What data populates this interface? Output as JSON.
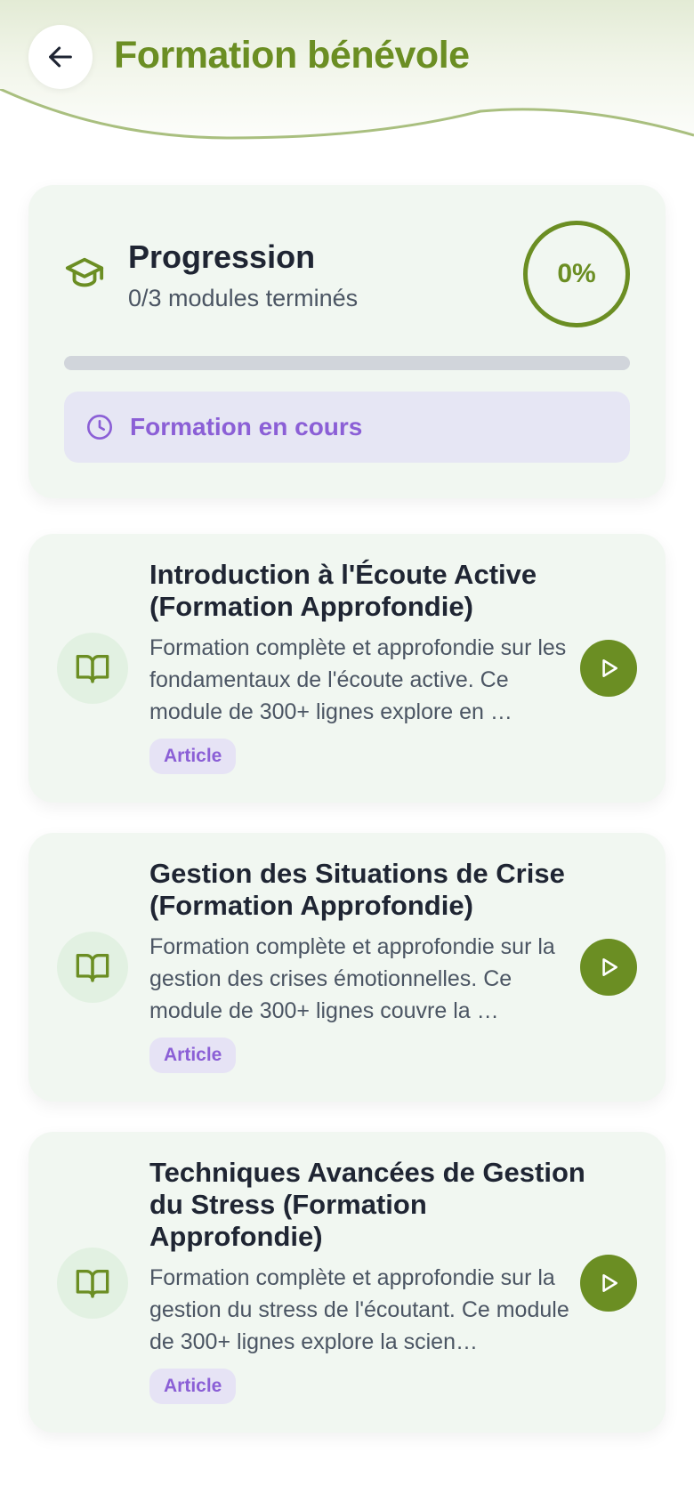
{
  "header": {
    "title": "Formation bénévole",
    "back_icon": "arrow-left-icon"
  },
  "progress": {
    "icon": "graduation-cap-icon",
    "title": "Progression",
    "subtitle": "0/3 modules terminés",
    "percent_label": "0%",
    "completed_fraction": 0,
    "status_icon": "clock-icon",
    "status_text": "Formation en cours"
  },
  "modules": [
    {
      "title": "Introduction à l'Écoute Active (Formation Approfondie)",
      "description": "Formation complète et approfondie sur les fondamentaux de l'écoute active. Ce module de 300+ lignes explore en …",
      "badge": "Article",
      "icon": "book-open-icon",
      "action_icon": "play-icon"
    },
    {
      "title": "Gestion des Situations de Crise (Formation Approfondie)",
      "description": "Formation complète et approfondie sur la gestion des crises émotionnelles. Ce module de 300+ lignes couvre la …",
      "badge": "Article",
      "icon": "book-open-icon",
      "action_icon": "play-icon"
    },
    {
      "title": "Techniques Avancées de Gestion du Stress (Formation Approfondie)",
      "description": "Formation complète et approfondie sur la gestion du stress de l'écoutant. Ce module de 300+ lignes explore la scien…",
      "badge": "Article",
      "icon": "book-open-icon",
      "action_icon": "play-icon"
    }
  ],
  "colors": {
    "primary_green": "#6b8e23",
    "accent_purple": "#8b5fd6",
    "card_background": "#f1f7f1",
    "status_background": "#e6e6f4"
  }
}
